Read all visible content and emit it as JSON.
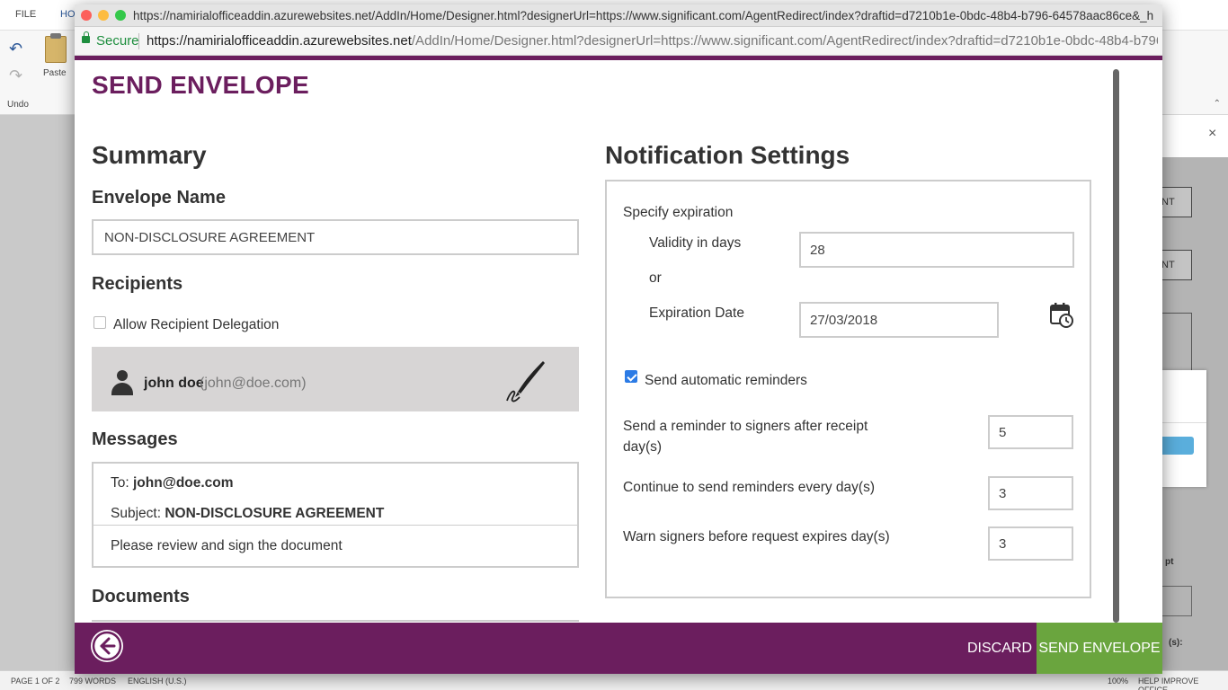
{
  "word": {
    "tabs": [
      "FILE",
      "HO"
    ],
    "paste_label": "Paste",
    "undo_label": "Undo",
    "status": {
      "page": "PAGE 1 OF 2",
      "words": "799 WORDS",
      "language": "ENGLISH (U.S.)",
      "zoom": "100%",
      "help": "HELP IMPROVE OFFICE"
    }
  },
  "taskpane": {
    "close": "×",
    "btn1": "NT",
    "btn2": "NT",
    "label1": "pt",
    "label2": "(s):"
  },
  "browser": {
    "title_url": "https://namirialofficeaddin.azurewebsites.net/AddIn/Home/Designer.html?designerUrl=https://www.significant.com/AgentRedirect/index?draftid=d7210b1e-0bdc-48b4-b796-64578aac86ce&_h...",
    "secure_label": "Secure",
    "url_host": "https://namirialofficeaddin.azurewebsites.net",
    "url_path": "/AddIn/Home/Designer.html?designerUrl=https://www.significant.com/AgentRedirect/index?draftid=d7210b1e-0bdc-48b4-b796-6457..."
  },
  "page": {
    "title": "SEND ENVELOPE"
  },
  "summary": {
    "heading": "Summary",
    "envelope_name_label": "Envelope Name",
    "envelope_name_value": "NON-DISCLOSURE AGREEMENT",
    "recipients_heading": "Recipients",
    "allow_delegation_label": "Allow Recipient Delegation",
    "recipient": {
      "name": "john doe",
      "email": "(john@doe.com)"
    },
    "messages_heading": "Messages",
    "messages": {
      "to_label": "To:",
      "to_value": "john@doe.com",
      "subject_label": "Subject:",
      "subject_value": "NON-DISCLOSURE AGREEMENT",
      "body": "Please review and sign the document"
    },
    "documents_heading": "Documents"
  },
  "notifications": {
    "heading": "Notification Settings",
    "specify_expiration": "Specify expiration",
    "validity_label": "Validity in days",
    "validity_value": "28",
    "or_label": "or",
    "expiration_label": "Expiration Date",
    "expiration_value": "27/03/2018",
    "auto_reminders_label": "Send automatic reminders",
    "reminder_after_label": "Send a reminder to signers after receipt",
    "reminder_after_unit": "day(s)",
    "reminder_after_value": "5",
    "continue_label": "Continue to send reminders every day(s)",
    "continue_value": "3",
    "warn_label": "Warn signers before request expires day(s)",
    "warn_value": "3"
  },
  "footer": {
    "discard_label": "DISCARD",
    "send_label": "SEND ENVELOPE"
  },
  "colors": {
    "brand_purple": "#6b1e5e",
    "send_green": "#6aa53e",
    "checkbox_blue": "#2c7be5"
  }
}
